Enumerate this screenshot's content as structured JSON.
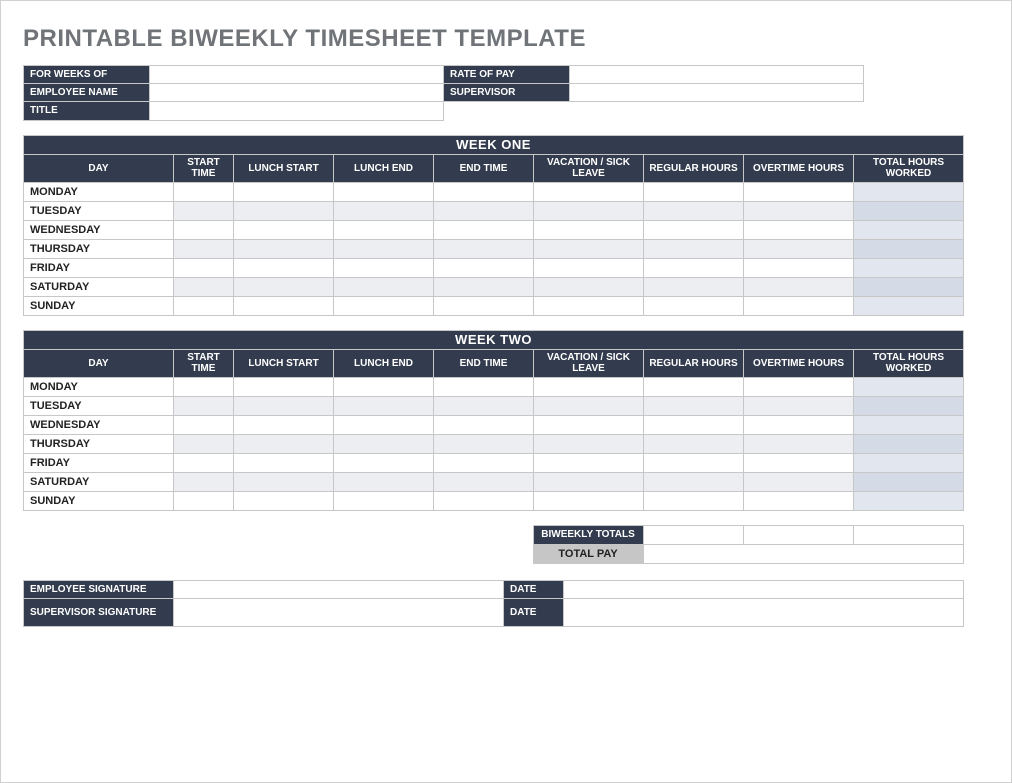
{
  "title": "PRINTABLE BIWEEKLY TIMESHEET TEMPLATE",
  "info": {
    "for_weeks_of_label": "FOR WEEKS OF",
    "for_weeks_of_value": "",
    "rate_of_pay_label": "RATE OF PAY",
    "rate_of_pay_value": "",
    "employee_name_label": "EMPLOYEE NAME",
    "employee_name_value": "",
    "supervisor_label": "SUPERVISOR",
    "supervisor_value": "",
    "title_label": "TITLE",
    "title_value": ""
  },
  "columns": {
    "day": "DAY",
    "start_time": "START TIME",
    "lunch_start": "LUNCH START",
    "lunch_end": "LUNCH END",
    "end_time": "END TIME",
    "vacation_sick": "VACATION / SICK LEAVE",
    "regular_hours": "REGULAR HOURS",
    "overtime_hours": "OVERTIME HOURS",
    "total_hours": "TOTAL HOURS WORKED"
  },
  "week_one": {
    "banner": "WEEK ONE",
    "days": [
      "MONDAY",
      "TUESDAY",
      "WEDNESDAY",
      "THURSDAY",
      "FRIDAY",
      "SATURDAY",
      "SUNDAY"
    ]
  },
  "week_two": {
    "banner": "WEEK TWO",
    "days": [
      "MONDAY",
      "TUESDAY",
      "WEDNESDAY",
      "THURSDAY",
      "FRIDAY",
      "SATURDAY",
      "SUNDAY"
    ]
  },
  "totals": {
    "biweekly_label": "BIWEEKLY TOTALS",
    "total_pay_label": "TOTAL PAY",
    "regular_total": "",
    "overtime_total": "",
    "hours_total": "",
    "total_pay_value": ""
  },
  "signatures": {
    "employee_sig_label": "EMPLOYEE SIGNATURE",
    "employee_sig_value": "",
    "employee_date_label": "DATE",
    "employee_date_value": "",
    "supervisor_sig_label": "SUPERVISOR SIGNATURE",
    "supervisor_sig_value": "",
    "supervisor_date_label": "DATE",
    "supervisor_date_value": ""
  }
}
